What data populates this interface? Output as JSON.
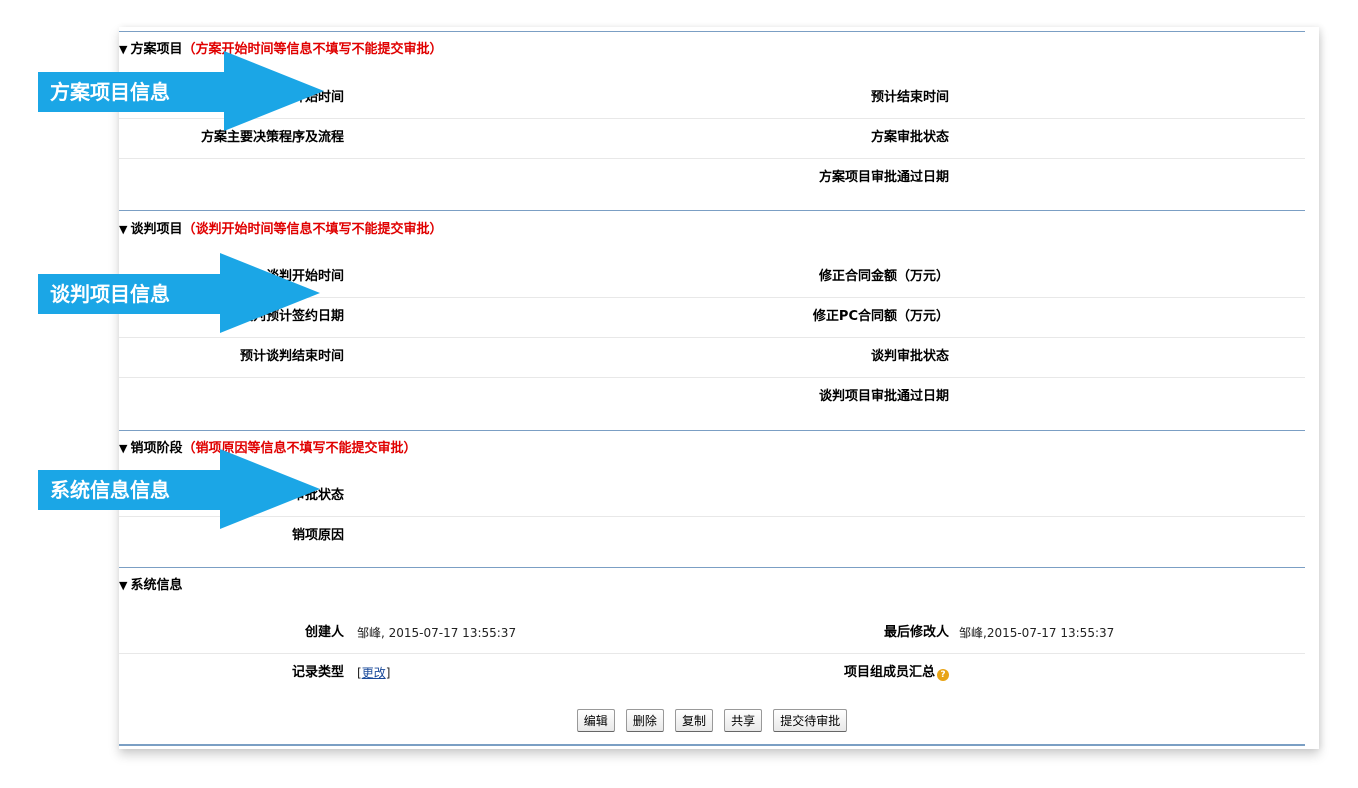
{
  "sections": {
    "plan": {
      "title": "方案项目",
      "note": "（方案开始时间等信息不填写不能提交审批）",
      "fields": {
        "start_time": "方案开始时间",
        "expected_end_time": "预计结束时间",
        "decision_process": "方案主要决策程序及流程",
        "approval_status": "方案审批状态",
        "approval_date": "方案项目审批通过日期"
      }
    },
    "negotiation": {
      "title": "谈判项目",
      "note": "（谈判开始时间等信息不填写不能提交审批）",
      "fields": {
        "start_time": "谈判开始时间",
        "amended_amount": "修正合同金额（万元）",
        "expected_sign_date": "谈判预计签约日期",
        "amended_pc_amount": "修正PC合同额（万元）",
        "expected_end_time": "预计谈判结束时间",
        "approval_status": "谈判审批状态",
        "approval_date": "谈判项目审批通过日期"
      }
    },
    "cancel": {
      "title": "销项阶段",
      "note": "（销项原因等信息不填写不能提交审批）",
      "fields": {
        "approval_status": "销项审批状态",
        "reason": "销项原因"
      }
    },
    "system": {
      "title": "系统信息",
      "fields": {
        "creator_label": "创建人",
        "creator_value": "邹峰, 2015-07-17 13:55:37",
        "modifier_label": "最后修改人",
        "modifier_value": "邹峰,2015-07-17 13:55:37",
        "record_type_label": "记录类型",
        "record_type_link": "更改",
        "team_summary_label": "项目组成员汇总"
      }
    }
  },
  "buttons": {
    "edit": "编辑",
    "delete": "删除",
    "copy": "复制",
    "share": "共享",
    "submit": "提交待审批"
  },
  "callouts": {
    "plan": "方案项目信息",
    "negotiation": "谈判项目信息",
    "system": "系统信息信息"
  },
  "icons": {
    "section_toggle": "triangle-down-icon",
    "help": "help-icon"
  },
  "colors": {
    "accent": "#1ba6e6",
    "note_red": "#e00000",
    "rule": "#7b9fc4"
  }
}
